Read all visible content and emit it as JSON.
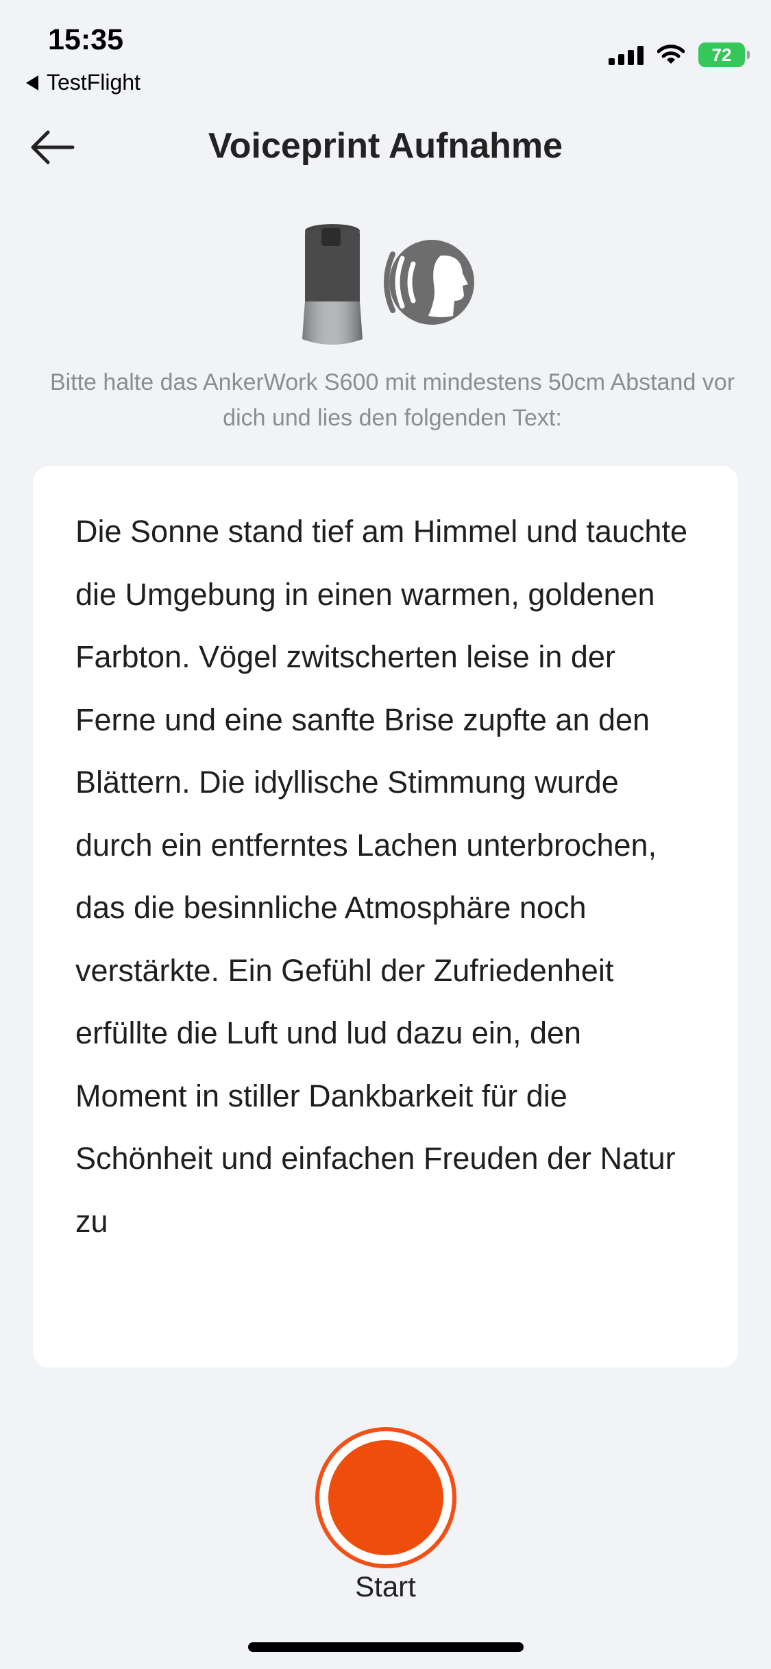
{
  "status_bar": {
    "time": "15:35",
    "back_app": "TestFlight",
    "battery": "72",
    "icons": [
      "signal-icon",
      "wifi-icon",
      "battery-charging-icon"
    ]
  },
  "header": {
    "title": "Voiceprint Aufnahme",
    "back_icon": "arrow-left-icon"
  },
  "illustration": {
    "icons": [
      "speaker-device-icon",
      "voice-speaking-icon"
    ]
  },
  "instruction": "Bitte halte das AnkerWork S600 mit mindestens 50cm Abstand vor dich und lies den folgenden Text:",
  "reading_text": "Die Sonne stand tief am Himmel und tauchte die Umgebung in einen warmen, goldenen Farbton. Vögel zwitscherten leise in der Ferne und eine sanfte Brise zupfte an den Blättern. Die idyllische Stimmung wurde durch ein entferntes Lachen unterbrochen, das die besinnliche Atmosphäre noch verstärkte. Ein Gefühl der Zufriedenheit erfüllte die Luft und lud dazu ein, den Moment in stiller Dankbarkeit für die Schönheit und einfachen Freuden der Natur zu",
  "record": {
    "label": "Start"
  },
  "colors": {
    "accent": "#ee4d0c",
    "background": "#f1f3f7",
    "battery": "#35c759"
  }
}
